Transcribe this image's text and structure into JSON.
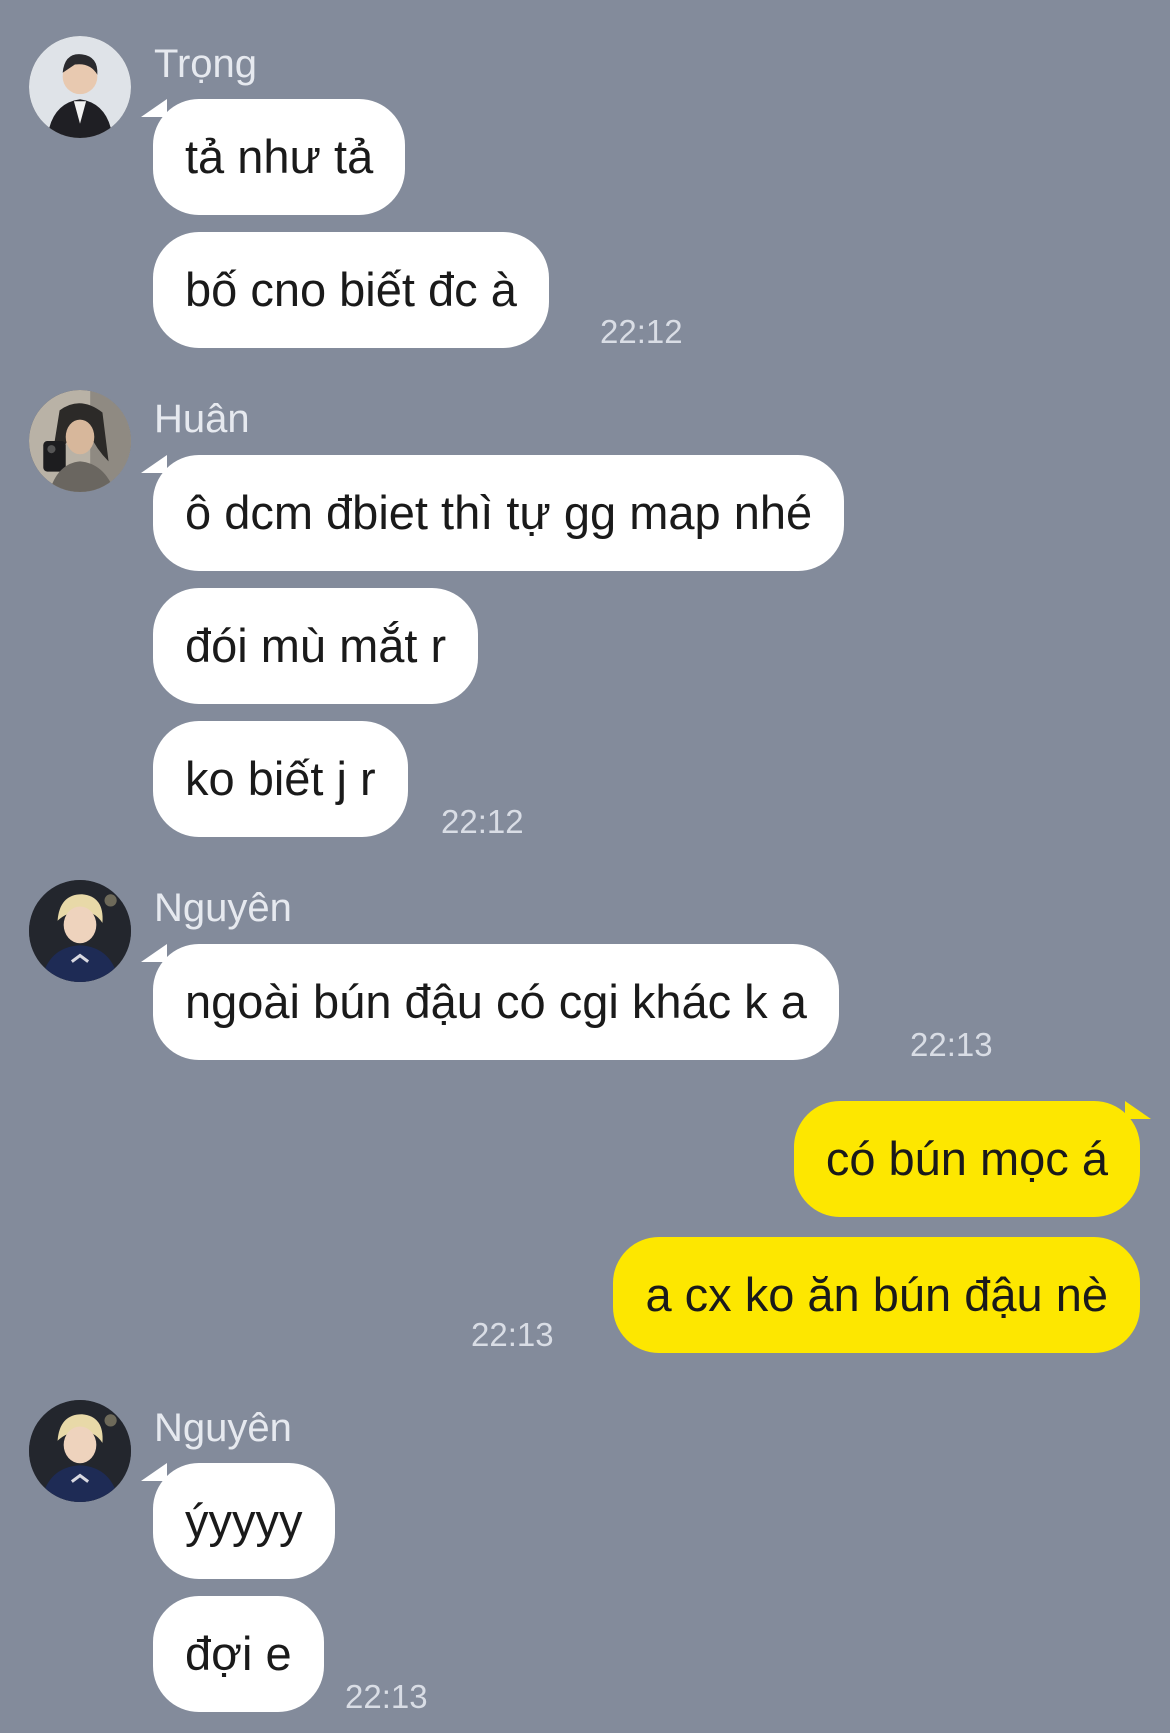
{
  "colors": {
    "background": "#838b9b",
    "incoming_bubble": "#ffffff",
    "outgoing_bubble": "#fde700",
    "sender_name": "#e6e9ef",
    "timestamp": "#d9dde5"
  },
  "messages": [
    {
      "sender": "Trọng",
      "avatar": "avatar-icon",
      "texts": [
        "tả như tả",
        "bố cno biết đc à"
      ],
      "time": "22:12"
    },
    {
      "sender": "Huân",
      "avatar": "avatar-icon",
      "texts": [
        "ô dcm đbiet thì tự gg map nhé",
        "đói mù mắt r",
        "ko biết j r"
      ],
      "time": "22:12"
    },
    {
      "sender": "Nguyên",
      "avatar": "avatar-icon",
      "texts": [
        "ngoài bún đậu có cgi khác k a"
      ],
      "time": "22:13"
    },
    {
      "sender": "me",
      "texts": [
        "có bún mọc á",
        "a cx ko ăn bún đậu nè"
      ],
      "time": "22:13"
    },
    {
      "sender": "Nguyên",
      "avatar": "avatar-icon",
      "texts": [
        "ýyyyy",
        "đợi e"
      ],
      "time": "22:13"
    }
  ]
}
